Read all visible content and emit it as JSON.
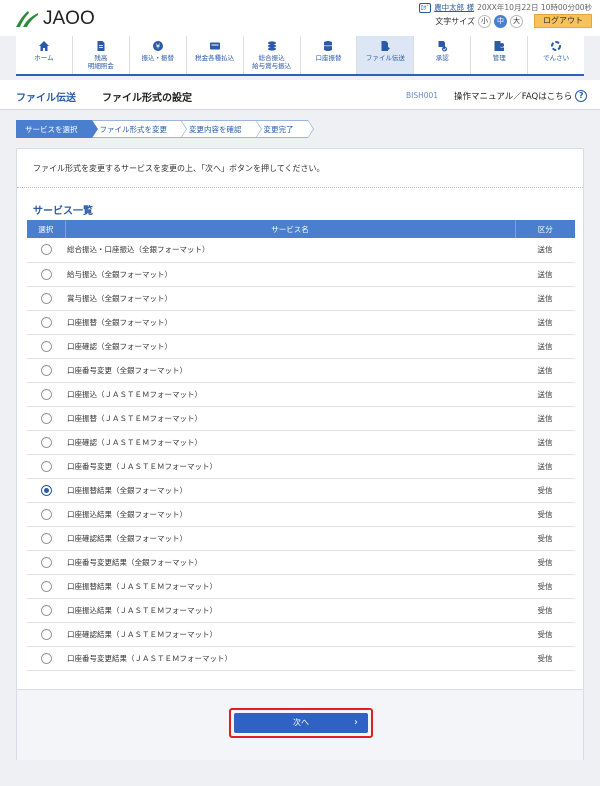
{
  "brand": {
    "logo_text": "JAOO"
  },
  "user": {
    "badge": "ﾛｸﾞ",
    "name": "農中太郎 様",
    "last_login": "20XX年10月22日 10時00分00秒"
  },
  "font_size": {
    "label": "文字サイズ",
    "small": "小",
    "medium": "中",
    "large": "大"
  },
  "logout_label": "ログアウト",
  "nav": [
    {
      "label": "ホーム",
      "icon": "home-icon"
    },
    {
      "label": "残高\n明細照会",
      "icon": "document-icon"
    },
    {
      "label": "振込・振替",
      "icon": "yen-coin-icon"
    },
    {
      "label": "税金各種払込",
      "icon": "card-icon"
    },
    {
      "label": "総合振込\n給与賞与振込",
      "icon": "coins-stack-icon"
    },
    {
      "label": "口座振替",
      "icon": "database-icon"
    },
    {
      "label": "ファイル伝送",
      "icon": "file-upload-icon"
    },
    {
      "label": "承認",
      "icon": "approval-icon"
    },
    {
      "label": "管理",
      "icon": "admin-icon"
    },
    {
      "label": "でんさい",
      "icon": "densai-icon"
    }
  ],
  "page": {
    "crumb": "ファイル伝送",
    "title": "ファイル形式の設定",
    "screen_id": "BISH001",
    "manual_link": "操作マニュアル／FAQはこちら"
  },
  "steps": [
    "サービスを選択",
    "ファイル形式を変更",
    "変更内容を確認",
    "変更完了"
  ],
  "instruction": "ファイル形式を変更するサービスを変更の上、「次へ」ボタンを押してください。",
  "section_title": "サービス一覧",
  "table": {
    "headers": {
      "select": "選択",
      "name": "サービス名",
      "kind": "区分"
    },
    "rows": [
      {
        "name": "総合振込・口座振込（全銀フォーマット）",
        "kind": "送信",
        "checked": false
      },
      {
        "name": "給与振込（全銀フォーマット）",
        "kind": "送信",
        "checked": false
      },
      {
        "name": "賞与振込（全銀フォーマット）",
        "kind": "送信",
        "checked": false
      },
      {
        "name": "口座振替（全銀フォーマット）",
        "kind": "送信",
        "checked": false
      },
      {
        "name": "口座確認（全銀フォーマット）",
        "kind": "送信",
        "checked": false
      },
      {
        "name": "口座番号変更（全銀フォーマット）",
        "kind": "送信",
        "checked": false
      },
      {
        "name": "口座振込（ＪＡＳＴＥＭフォーマット）",
        "kind": "送信",
        "checked": false
      },
      {
        "name": "口座振替（ＪＡＳＴＥＭフォーマット）",
        "kind": "送信",
        "checked": false
      },
      {
        "name": "口座確認（ＪＡＳＴＥＭフォーマット）",
        "kind": "送信",
        "checked": false
      },
      {
        "name": "口座番号変更（ＪＡＳＴＥＭフォーマット）",
        "kind": "送信",
        "checked": false
      },
      {
        "name": "口座振替結果（全銀フォーマット）",
        "kind": "受信",
        "checked": true
      },
      {
        "name": "口座振込結果（全銀フォーマット）",
        "kind": "受信",
        "checked": false
      },
      {
        "name": "口座確認結果（全銀フォーマット）",
        "kind": "受信",
        "checked": false
      },
      {
        "name": "口座番号変更結果（全銀フォーマット）",
        "kind": "受信",
        "checked": false
      },
      {
        "name": "口座振替結果（ＪＡＳＴＥＭフォーマット）",
        "kind": "受信",
        "checked": false
      },
      {
        "name": "口座振込結果（ＪＡＳＴＥＭフォーマット）",
        "kind": "受信",
        "checked": false
      },
      {
        "name": "口座確認結果（ＪＡＳＴＥＭフォーマット）",
        "kind": "受信",
        "checked": false
      },
      {
        "name": "口座番号変更結果（ＪＡＳＴＥＭフォーマット）",
        "kind": "受信",
        "checked": false
      }
    ]
  },
  "next_label": "次へ",
  "colors": {
    "primary": "#2f62c4",
    "accent": "#4a7fd0",
    "logout": "#f7c15b",
    "highlight": "#e02020"
  }
}
